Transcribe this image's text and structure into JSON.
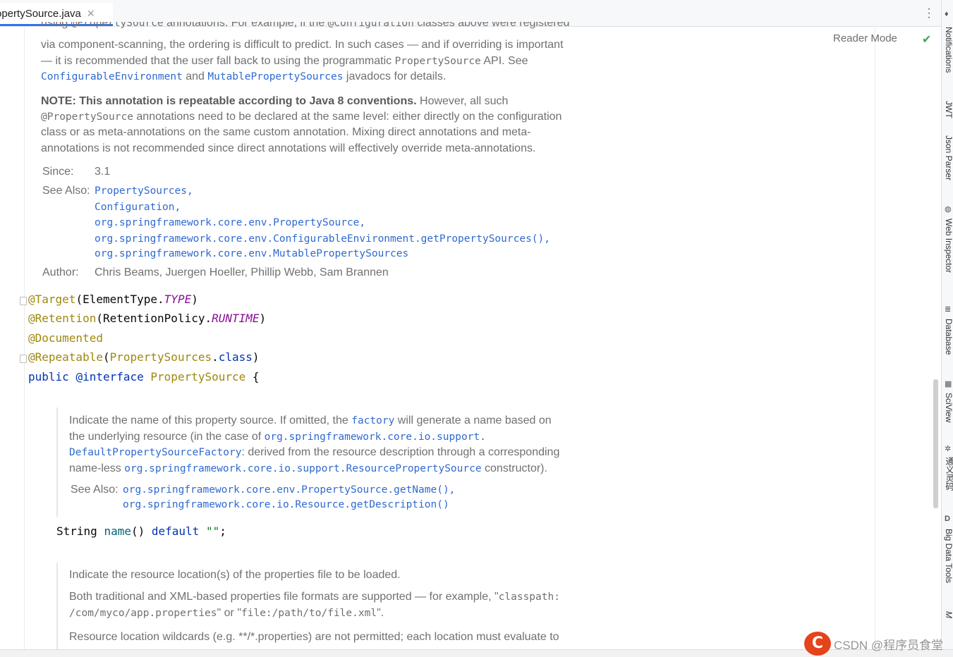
{
  "tab": {
    "filename": "opertySource.java",
    "close": "✕"
  },
  "toolbar": {
    "kebab": "⋮",
    "reader_mode": "Reader Mode",
    "check": "✔"
  },
  "right_tools": [
    {
      "label": "Notifications"
    },
    {
      "label": "JWT"
    },
    {
      "label": "Json Parser"
    },
    {
      "label": "Web Inspector"
    },
    {
      "label": "Database"
    },
    {
      "label": "SciView"
    },
    {
      "label": "通义灵码"
    },
    {
      "label": "Big Data Tools"
    },
    {
      "label": "M"
    }
  ],
  "doc1": {
    "line1": {
      "a": "using ",
      "c1": "@PropertySource",
      "b": " annotations. For example, if the ",
      "c2": "@Configuration",
      "d": " classes above were registered"
    },
    "line2": "via component-scanning, the ordering is difficult to predict. In such cases — and if overriding is important",
    "line3": {
      "a": "— it is recommended that the user fall back to using the programmatic ",
      "c": "PropertySource",
      "b": " API. See"
    },
    "line4": {
      "l1": "ConfigurableEnvironment",
      "a": " and ",
      "l2": "MutablePropertySources",
      "b": " javadocs for details."
    },
    "note": {
      "bold": "NOTE: This annotation is repeatable according to Java 8 conventions.",
      "a": " However, all such"
    },
    "note2": {
      "c": "@PropertySource",
      "a": " annotations need to be declared at the same level: either directly on the configuration"
    },
    "note3": "class or as meta-annotations on the same custom annotation. Mixing direct annotations and meta-",
    "note4": "annotations is not recommended since direct annotations will effectively override meta-annotations.",
    "since_label": "Since:",
    "since_value": "3.1",
    "see_also_label": "See Also:",
    "see_also": [
      "PropertySources,",
      "Configuration,",
      "org.springframework.core.env.PropertySource,",
      "org.springframework.core.env.ConfigurableEnvironment.getPropertySources(),",
      "org.springframework.core.env.MutablePropertySources"
    ],
    "author_label": "Author:",
    "author_value": "Chris Beams, Juergen Hoeller, Phillip Webb, Sam Brannen"
  },
  "code": {
    "target": {
      "ann": "@Target",
      "p1": "(ElementType.",
      "it": "TYPE",
      "p2": ")"
    },
    "retention": {
      "ann": "@Retention",
      "p1": "(RetentionPolicy.",
      "it": "RUNTIME",
      "p2": ")"
    },
    "documented": "@Documented",
    "repeatable": {
      "ann": "@Repeatable",
      "p1": "(",
      "cls": "PropertySources",
      "p2": ".",
      "kw": "class",
      "p3": ")"
    },
    "decl": {
      "kw1": "public",
      "kw2": "@interface",
      "name": "PropertySource",
      "brace": "{"
    },
    "name_method": {
      "type": "String ",
      "fn": "name",
      "p": "() ",
      "kw": "default",
      "str": "\"\"",
      "end": ";"
    }
  },
  "doc2": {
    "line1": {
      "a": "Indicate the name of this property source. If omitted, the ",
      "l": "factory",
      "b": " will generate a name based on"
    },
    "line2": {
      "a": "the underlying resource (in the case of ",
      "l": "org.springframework.core.io.support."
    },
    "line3": {
      "l": "DefaultPropertySourceFactory",
      "a": ": derived from the resource description through a corresponding"
    },
    "line4": {
      "a": "name-less ",
      "l": "org.springframework.core.io.support.ResourcePropertySource",
      "b": " constructor)."
    },
    "see_also_label": "See Also:",
    "see_also": [
      "org.springframework.core.env.PropertySource.getName(),",
      "org.springframework.core.io.Resource.getDescription()"
    ]
  },
  "doc3": {
    "line1": "Indicate the resource location(s) of the properties file to be loaded.",
    "line2": {
      "a": "Both traditional and XML-based properties file formats are supported — for example, \"",
      "c": "classpath:"
    },
    "line3": {
      "c1": "/com/myco/app.properties",
      "a": "\" or \"",
      "c2": "file:/path/to/file.xml",
      "b": "\"."
    },
    "line4": "Resource location wildcards (e.g. **/*.properties) are not permitted; each location must evaluate to"
  },
  "watermark": {
    "logo": "C",
    "text": "CSDN @程序员食堂"
  }
}
